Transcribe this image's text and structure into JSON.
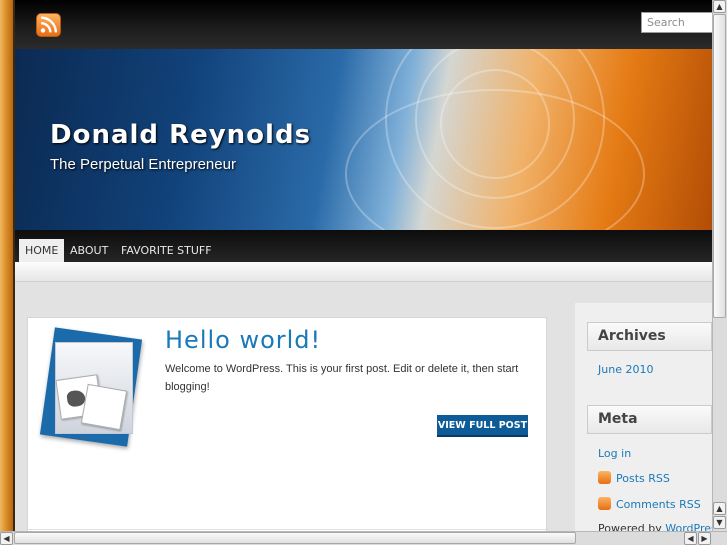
{
  "header": {
    "search_placeholder": "Search",
    "rss_icon": "rss-icon"
  },
  "banner": {
    "title": "Donald Reynolds",
    "description": "The Perpetual Entrepreneur"
  },
  "nav": {
    "items": [
      {
        "label": "HOME",
        "active": true
      },
      {
        "label": "ABOUT",
        "active": false
      },
      {
        "label": "FAVORITE STUFF",
        "active": false
      }
    ]
  },
  "post": {
    "title": "Hello world!",
    "excerpt": "Welcome to WordPress. This is your first post. Edit or delete it, then start blogging!",
    "button_label": "VIEW FULL POST"
  },
  "sidebar": {
    "archives": {
      "title": "Archives",
      "links": [
        "June 2010"
      ]
    },
    "meta": {
      "title": "Meta",
      "login": "Log in",
      "posts_rss": "Posts RSS",
      "comments_rss": "Comments RSS",
      "powered_prefix": "Powered by ",
      "powered_link": "WordPress"
    }
  },
  "colors": {
    "accent_blue": "#1a79b8",
    "button_blue": "#0e5c97",
    "rss_orange": "#ea6d12"
  }
}
